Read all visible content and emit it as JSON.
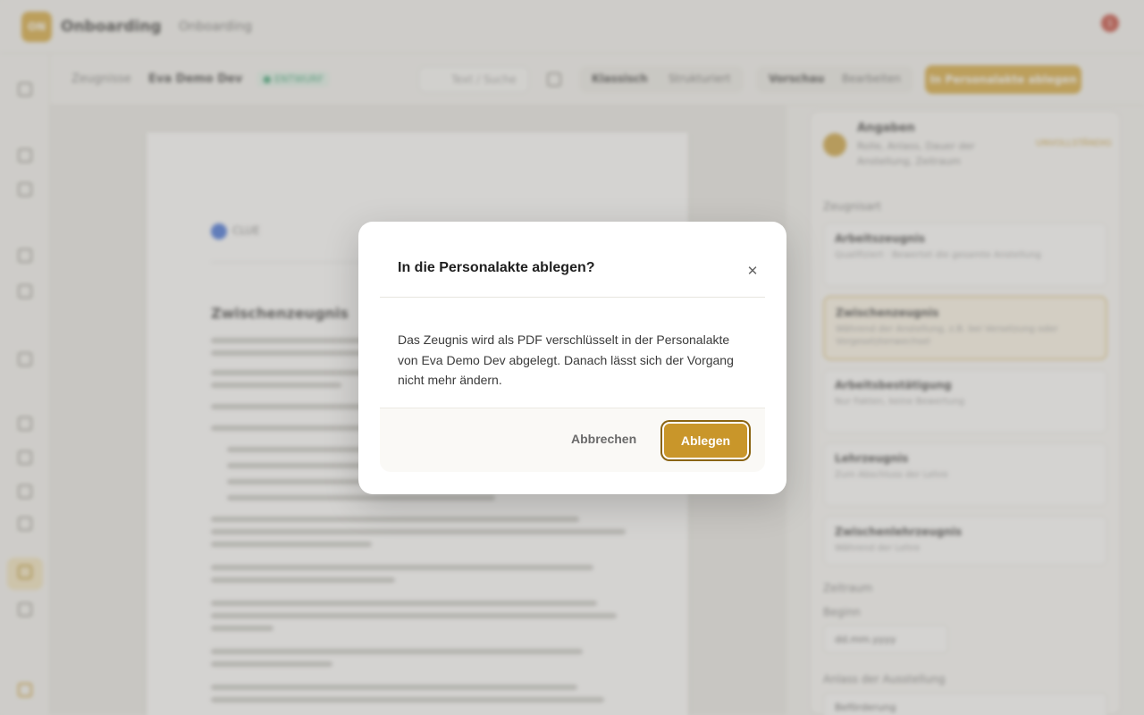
{
  "app": {
    "logo_text": "ON",
    "name": "Onboarding",
    "section": "Onboarding",
    "notification_count": "1"
  },
  "toolbar": {
    "breadcrumb_root": "Zeugnisse",
    "employee_name": "Eva Demo Dev",
    "status_badge": "● ENTWURF",
    "search_placeholder": "Text / Suche",
    "view_tabs": [
      "Klassisch",
      "Strukturiert"
    ],
    "mode_tabs": [
      "Vorschau",
      "Bearbeiten"
    ],
    "primary_action": "In Personalakte ablegen"
  },
  "document": {
    "logo_text": "CLUE",
    "heading": "Zwischenzeugnis"
  },
  "panel": {
    "title": "Angaben",
    "subtitle": "Rolle, Anlass, Dauer der Anstellung, Zeitraum",
    "status": "UNVOLLSTÄNDIG",
    "types_label": "Zeugnisart",
    "types": [
      {
        "title": "Arbeitszeugnis",
        "desc": "Qualifiziert · Bewertet die gesamte Anstellung"
      },
      {
        "title": "Zwischenzeugnis",
        "desc": "Während der Anstellung, z.B. bei Versetzung oder Vorgesetztenwechsel"
      },
      {
        "title": "Arbeitsbestätigung",
        "desc": "Nur Fakten, keine Bewertung"
      },
      {
        "title": "Lehrzeugnis",
        "desc": "Zum Abschluss der Lehre"
      },
      {
        "title": "Zwischenlehrzeugnis",
        "desc": "Während der Lehre"
      }
    ],
    "period_label": "Zeitraum",
    "begin_label": "Beginn",
    "begin_value": "dd.mm.yyyy",
    "reason_label": "Anlass der Ausstellung",
    "reason_value": "Beförderung"
  },
  "modal": {
    "title": "In die Personalakte ablegen?",
    "body": "Das Zeugnis wird als PDF verschlüsselt in der Personalakte von Eva Demo Dev abgelegt. Danach lässt sich der Vorgang nicht mehr ändern.",
    "cancel_label": "Abbrechen",
    "confirm_label": "Ablegen",
    "close_glyph": "✕"
  },
  "colors": {
    "accent": "#c9962a",
    "accent_dark": "#8a6412"
  }
}
